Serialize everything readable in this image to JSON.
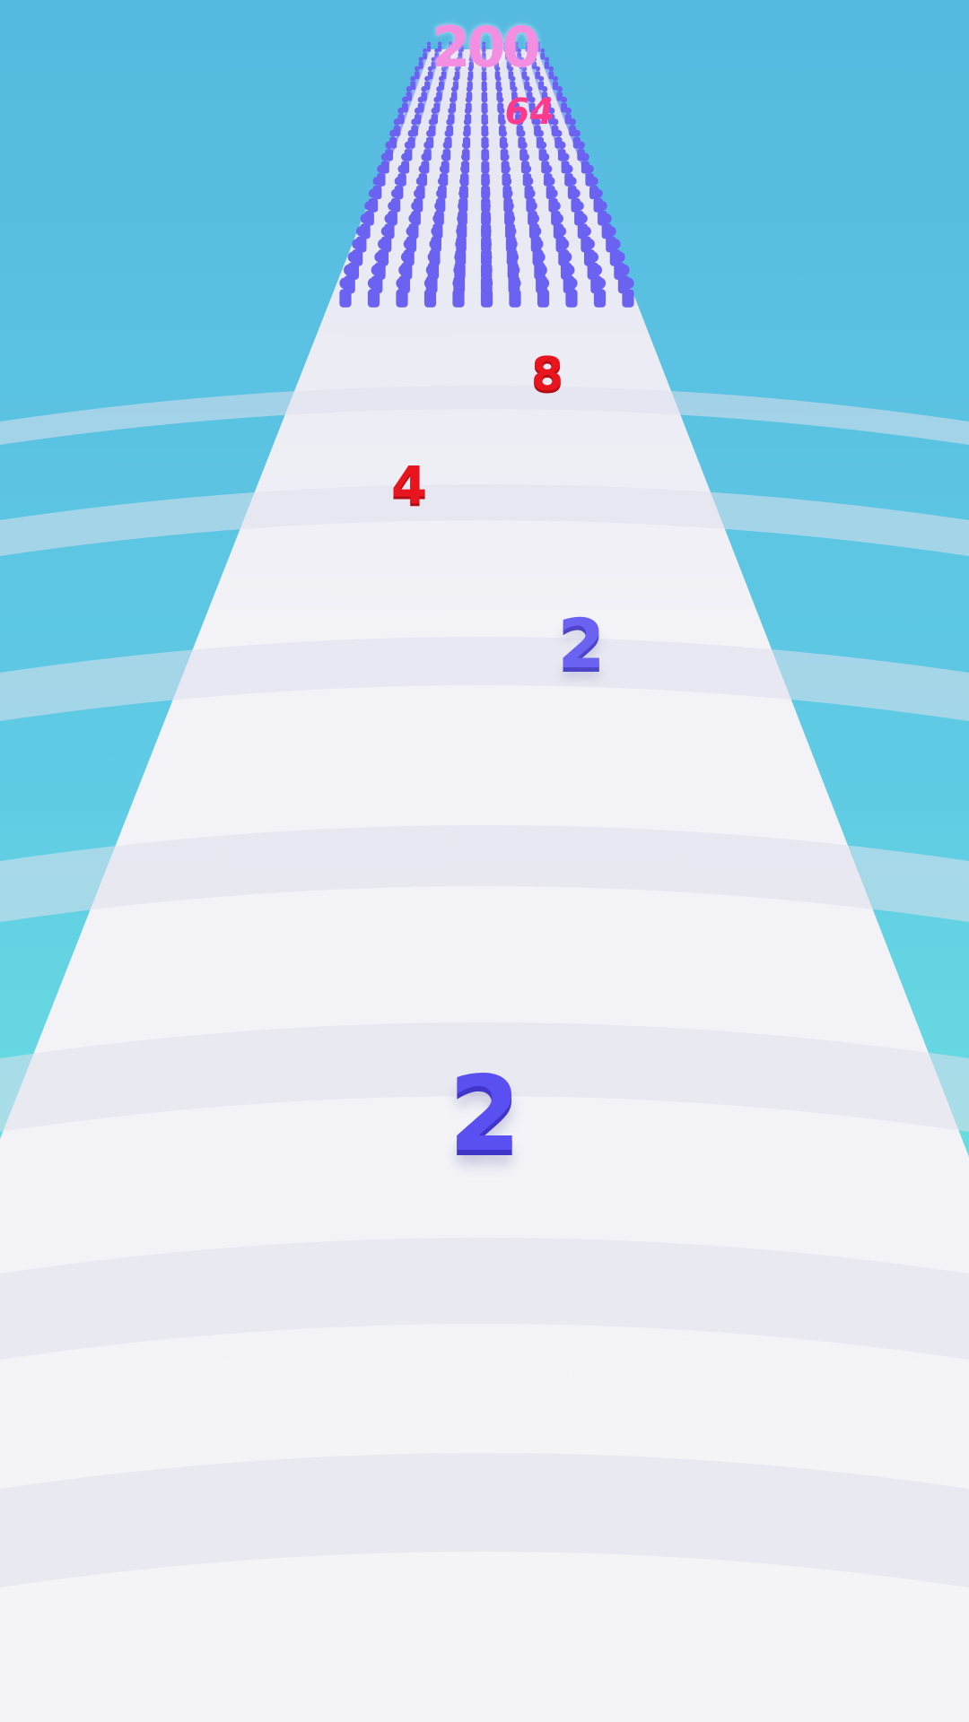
{
  "hud": {
    "target_count": "200",
    "track_marker": "64"
  },
  "pickups": {
    "far_red": "8",
    "mid_red": "4",
    "near_blue": "2"
  },
  "player": {
    "count": "2"
  },
  "colors": {
    "sky_top": "#56b9e0",
    "sky_bottom": "#7cf0dc",
    "track": "#f1f1f6",
    "crowd_blue": "#6b62f2",
    "player_blue": "#5a4ff0",
    "pickup_red": "#e8141e",
    "marker_pink": "#ff3a8c",
    "target_pink": "#f48ee0"
  },
  "crowd": {
    "columns": 11,
    "rows": 22
  }
}
